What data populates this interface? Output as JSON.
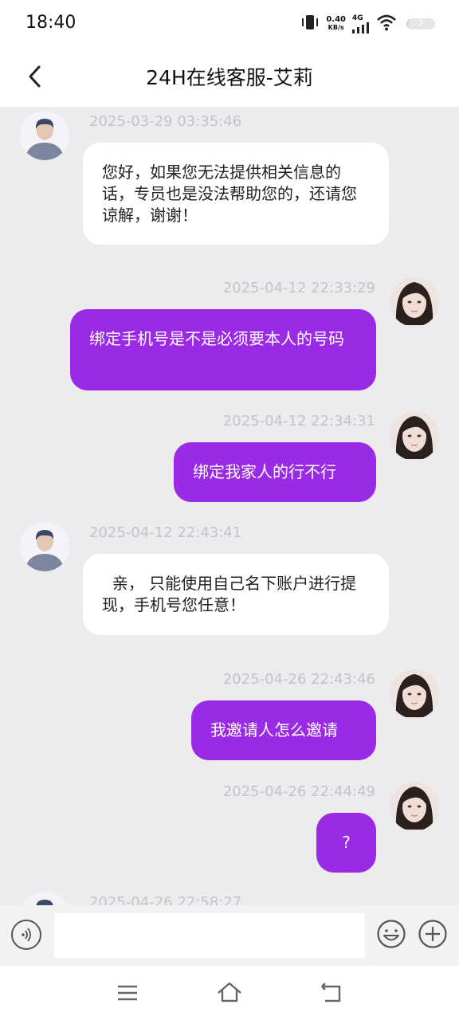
{
  "status_bar": {
    "time": "18:40",
    "net_speed_value": "0.40",
    "net_speed_unit": "KB/s",
    "network_type": "4G",
    "battery_level": "7",
    "icons": [
      "vibrate-icon",
      "network-speed",
      "signal-icon",
      "wifi-icon",
      "battery-icon"
    ]
  },
  "header": {
    "title": "24H在线客服-艾莉",
    "back_icon": "chevron-left-icon"
  },
  "messages": [
    {
      "sender": "agent",
      "timestamp": "2025-03-29 03:35:46",
      "text": "您好，如果您无法提供相关信息的话，专员也是没法帮助您的，还请您谅解，谢谢！"
    },
    {
      "sender": "user",
      "timestamp": "2025-04-12 22:33:29",
      "text": "绑定手机号是不是必须要本人的号码"
    },
    {
      "sender": "user",
      "timestamp": "2025-04-12 22:34:31",
      "text": "绑定我家人的行不行"
    },
    {
      "sender": "agent",
      "timestamp": "2025-04-12 22:43:41",
      "text": "  亲， 只能使用自己名下账户进行提现，手机号您任意！"
    },
    {
      "sender": "user",
      "timestamp": "2025-04-26 22:43:46",
      "text": "我邀请人怎么邀请"
    },
    {
      "sender": "user",
      "timestamp": "2025-04-26 22:44:49",
      "text": "?"
    },
    {
      "sender": "agent",
      "timestamp": "2025-04-26 22:58:27",
      "text": ""
    }
  ],
  "input_bar": {
    "placeholder": "",
    "icons": [
      "voice-icon",
      "emoji-icon",
      "plus-icon"
    ]
  },
  "nav_bar": {
    "icons": [
      "menu-icon",
      "home-icon",
      "back-icon"
    ]
  },
  "colors": {
    "user_bubble": "#9b2ae6",
    "agent_bubble": "#ffffff",
    "chat_background": "#ececee",
    "timestamp": "#c4c4c8"
  }
}
